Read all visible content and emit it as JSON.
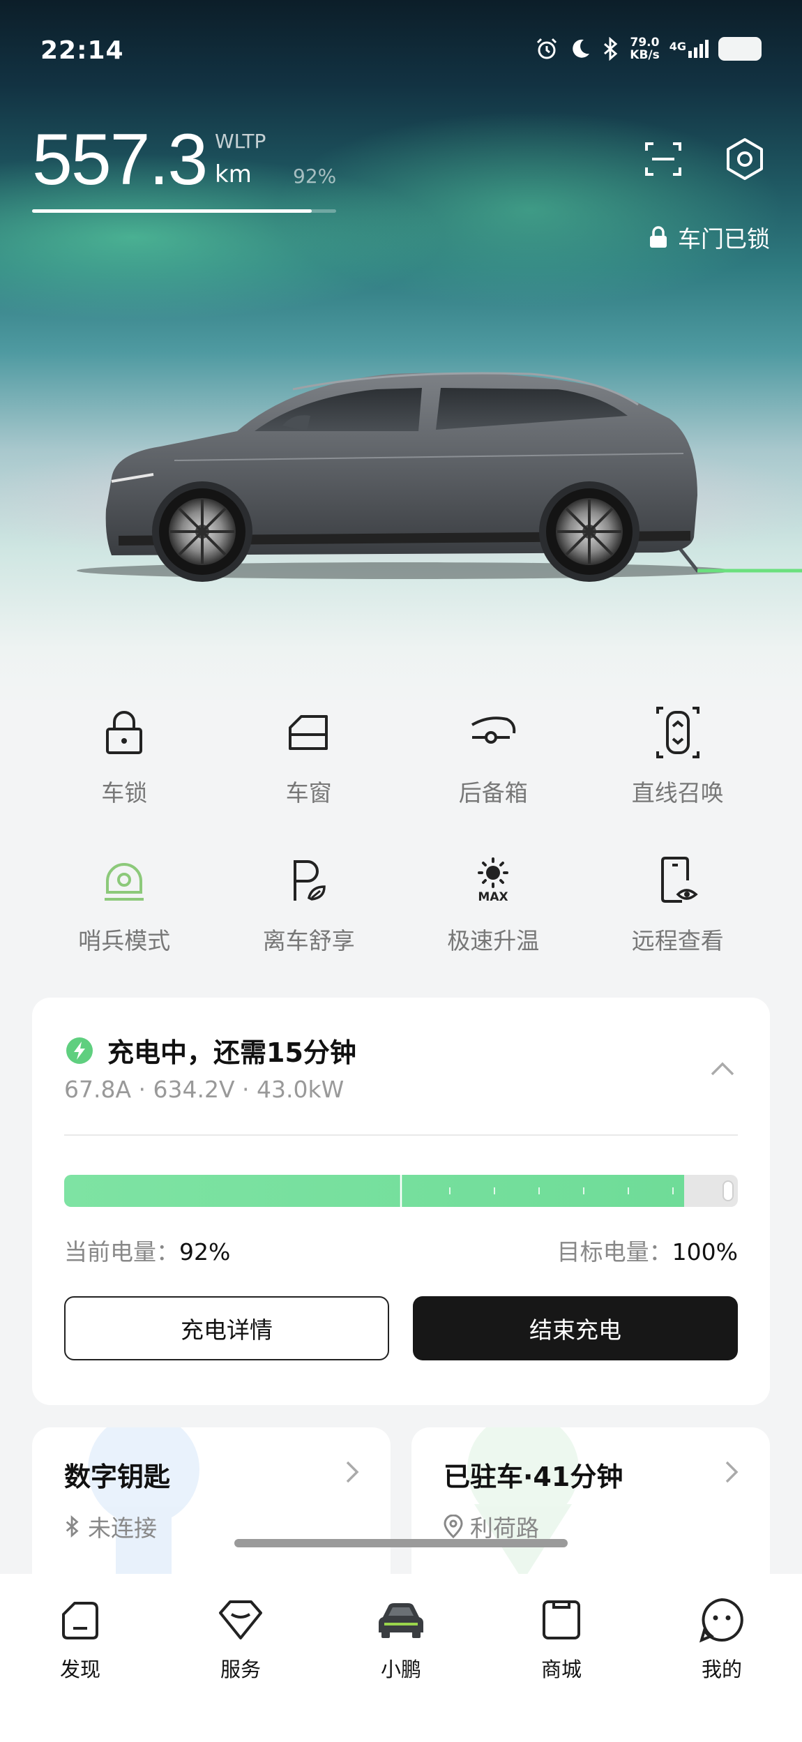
{
  "status_bar": {
    "time": "22:14",
    "net_speed_value": "79.0",
    "net_speed_unit": "KB/s",
    "net_type": "4G",
    "icons": [
      "alarm-icon",
      "moon-icon",
      "bluetooth-icon",
      "signal-icon",
      "battery-icon"
    ]
  },
  "range": {
    "value": "557.3",
    "unit": "km",
    "standard": "WLTP",
    "battery_percent_label": "92%",
    "battery_fraction": 0.92
  },
  "top_actions": {
    "scan_icon": "scan-icon",
    "settings_icon": "settings-hex-icon"
  },
  "lock_status": {
    "text": "车门已锁",
    "icon": "lock-icon"
  },
  "controls": [
    {
      "label": "车锁",
      "icon": "lock-icon"
    },
    {
      "label": "车窗",
      "icon": "window-icon"
    },
    {
      "label": "后备箱",
      "icon": "trunk-icon"
    },
    {
      "label": "直线召唤",
      "icon": "summon-icon"
    },
    {
      "label": "哨兵模式",
      "icon": "sentry-icon",
      "active_color": "#8cc97a"
    },
    {
      "label": "离车舒享",
      "icon": "parking-comfort-icon"
    },
    {
      "label": "极速升温",
      "icon": "max-heat-icon"
    },
    {
      "label": "远程查看",
      "icon": "remote-view-icon"
    }
  ],
  "charging": {
    "title": "充电中，还需15分钟",
    "metrics": "67.8A · 634.2V · 43.0kW",
    "current_label": "当前电量：",
    "current_value": "92%",
    "current_fraction": 0.92,
    "target_label": "目标电量：",
    "target_value": "100%",
    "target_fraction": 1.0,
    "detail_button": "充电详情",
    "stop_button": "结束充电",
    "accent_color": "#6fdc98"
  },
  "digital_key": {
    "title": "数字钥匙",
    "status": "未连接"
  },
  "parking": {
    "title": "已驻车·41分钟",
    "location": "利荷路"
  },
  "bottom_nav": [
    {
      "label": "发现",
      "icon": "discover-icon"
    },
    {
      "label": "服务",
      "icon": "service-icon"
    },
    {
      "label": "小鹏",
      "icon": "car-icon",
      "active": true
    },
    {
      "label": "商城",
      "icon": "mall-icon"
    },
    {
      "label": "我的",
      "icon": "profile-icon"
    }
  ]
}
